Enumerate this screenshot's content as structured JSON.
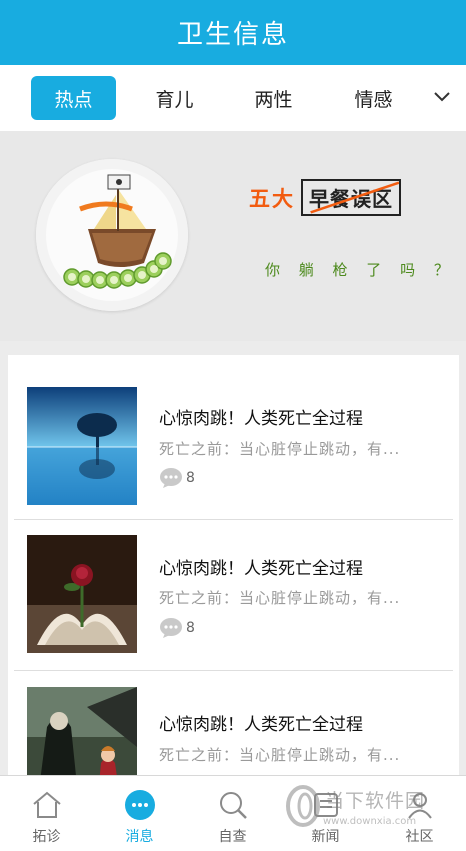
{
  "header": {
    "title": "卫生信息"
  },
  "tabs": [
    {
      "label": "热点",
      "active": true
    },
    {
      "label": "育儿",
      "active": false
    },
    {
      "label": "两性",
      "active": false
    },
    {
      "label": "情感",
      "active": false
    }
  ],
  "tabs_more_icon": "chevron-down-icon",
  "banner": {
    "title_highlight": "五大",
    "title_boxed": "早餐误区",
    "subtitle": "你 躺 枪 了 吗 ？"
  },
  "articles": [
    {
      "title": "心惊肉跳！人类死亡全过程",
      "summary": "死亡之前：当心脏停止跳动，有...",
      "comments": "8",
      "thumb": "lone-tree-reflection"
    },
    {
      "title": "心惊肉跳！人类死亡全过程",
      "summary": "死亡之前：当心脏停止跳动，有...",
      "comments": "8",
      "thumb": "rose-on-book"
    },
    {
      "title": "心惊肉跳！人类死亡全过程",
      "summary": "死亡之前：当心脏停止跳动，有...",
      "comments": "",
      "thumb": "reaper-and-girl"
    }
  ],
  "tabbar": [
    {
      "label": "拓诊",
      "icon": "home-icon",
      "active": false
    },
    {
      "label": "消息",
      "icon": "message-bubble-icon",
      "active": true
    },
    {
      "label": "自查",
      "icon": "search-icon",
      "active": false
    },
    {
      "label": "新闻",
      "icon": "news-icon",
      "active": false
    },
    {
      "label": "社区",
      "icon": "community-icon",
      "active": false
    }
  ],
  "watermark": {
    "brand": "当下软件园",
    "url": "www.downxia.com"
  },
  "colors": {
    "accent": "#18ace0",
    "banner_orange": "#f25c10",
    "banner_green": "#4d8a1d"
  }
}
